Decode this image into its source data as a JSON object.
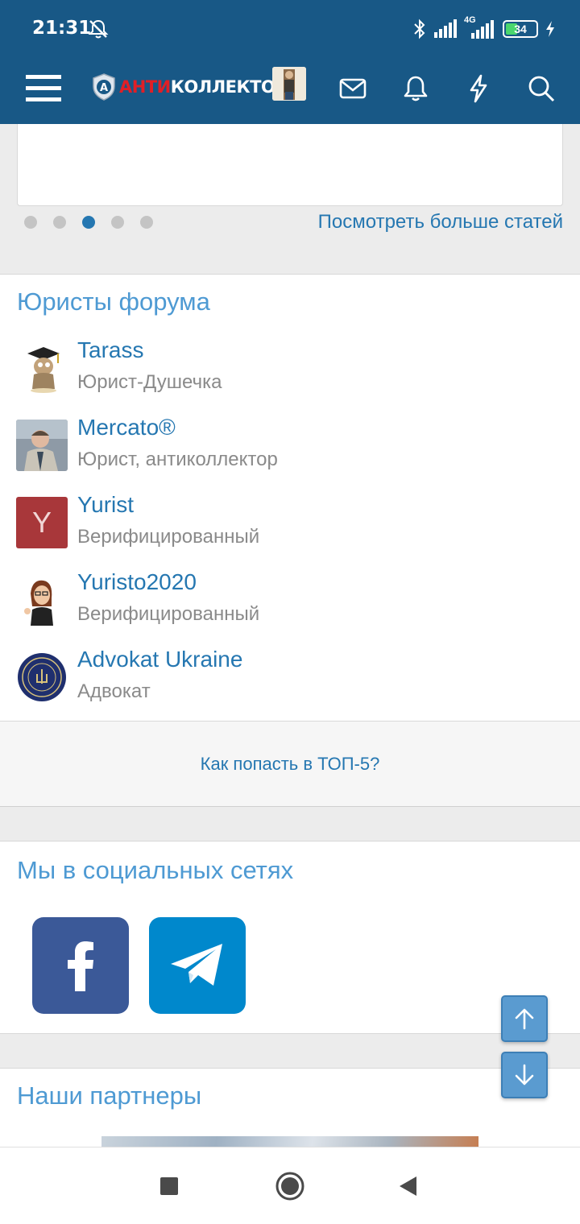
{
  "status_bar": {
    "time": "21:31",
    "battery": "34",
    "network": "4G",
    "icons": [
      "mute-icon",
      "bluetooth-icon",
      "signal-icon",
      "battery-icon",
      "charging-icon"
    ]
  },
  "header": {
    "logo_red": "АНТИ",
    "logo_white": "КОЛЛЕКТОР",
    "logo_badge": "А",
    "icons": [
      "menu-icon",
      "user-avatar",
      "mail-icon",
      "bell-icon",
      "lightning-icon",
      "search-icon"
    ],
    "bg_color": "#185886"
  },
  "articles": {
    "more_link": "Посмотреть больше статей",
    "dots_count": 5,
    "active_dot": 3
  },
  "lawyers": {
    "title": "Юристы форума",
    "items": [
      {
        "name": "Tarass",
        "role": "Юрист-Душечка"
      },
      {
        "name": "Mercato®",
        "role": "Юрист, антиколлектор"
      },
      {
        "name": "Yurist",
        "role": "Верифицированный",
        "avatar_letter": "Y"
      },
      {
        "name": "Yuristo2020",
        "role": "Верифицированный"
      },
      {
        "name": "Advokat Ukraine",
        "role": "Адвокат"
      }
    ],
    "top5_link": "Как попасть в ТОП-5?"
  },
  "social": {
    "title": "Мы в социальных сетях",
    "items": [
      {
        "name": "facebook",
        "color": "#3b5998"
      },
      {
        "name": "telegram",
        "color": "#0088cc"
      }
    ]
  },
  "partners": {
    "title": "Наши партнеры"
  },
  "colors": {
    "link": "#2577b1",
    "title": "#4e9ad3",
    "muted": "#8a8a8a"
  }
}
